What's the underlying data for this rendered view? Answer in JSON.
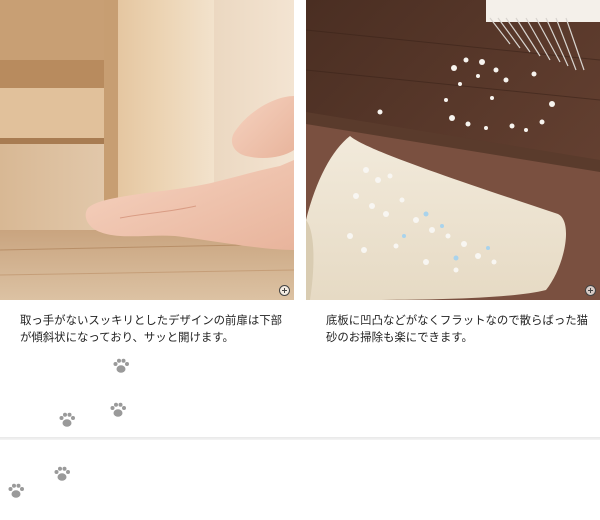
{
  "captions": {
    "left": "取っ手がないスッキリとしたデザインの前扉は下部が傾斜状になっており、サッと開けます。",
    "right": "底板に凹凸などがなくフラットなので散らばった猫砂のお掃除も楽にできます。"
  },
  "icons": {
    "zoom": "zoom-in-icon",
    "paw": "paw-print-icon"
  },
  "colors": {
    "paw": "#9a9a9a",
    "wood_light": "#e7c9a1",
    "wood_dark": "#5a3b2c",
    "divider": "#e8e8e8"
  }
}
